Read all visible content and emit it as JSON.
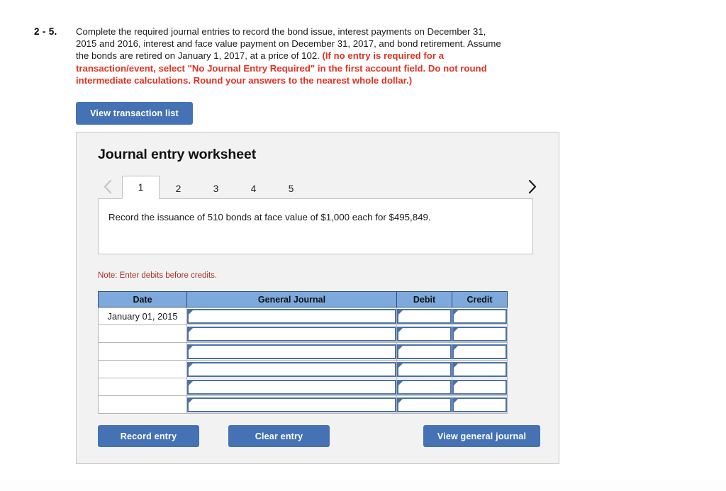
{
  "question": {
    "number": "2 - 5.",
    "text_plain_1": "Complete the required journal entries to record the bond issue, interest payments on December 31, 2015 and 2016, interest and face value payment on December 31, 2017, and bond retirement. Assume the bonds are retired on January 1, 2017, at a price of 102. ",
    "text_emphasis": "(If no entry is required for a transaction/event, select \"No Journal Entry Required\" in the first account field. Do not round intermediate calculations. Round your answers to the nearest whole dollar.)"
  },
  "toolbar": {
    "view_transaction_list_label": "View transaction list"
  },
  "worksheet": {
    "title": "Journal entry worksheet",
    "prev_icon": "chevron-left-icon",
    "next_icon": "chevron-right-icon",
    "tabs": [
      {
        "label": "1",
        "active": true
      },
      {
        "label": "2",
        "active": false
      },
      {
        "label": "3",
        "active": false
      },
      {
        "label": "4",
        "active": false
      },
      {
        "label": "5",
        "active": false
      }
    ],
    "description": "Record the issuance of 510 bonds at face value of $1,000 each for $495,849.",
    "note": "Note: Enter debits before credits.",
    "table": {
      "columns": [
        "Date",
        "General Journal",
        "Debit",
        "Credit"
      ],
      "rows": [
        {
          "date": "January 01, 2015",
          "general_journal": "",
          "debit": "",
          "credit": ""
        },
        {
          "date": "",
          "general_journal": "",
          "debit": "",
          "credit": ""
        },
        {
          "date": "",
          "general_journal": "",
          "debit": "",
          "credit": ""
        },
        {
          "date": "",
          "general_journal": "",
          "debit": "",
          "credit": ""
        },
        {
          "date": "",
          "general_journal": "",
          "debit": "",
          "credit": ""
        },
        {
          "date": "",
          "general_journal": "",
          "debit": "",
          "credit": ""
        }
      ]
    },
    "actions": {
      "record_entry_label": "Record entry",
      "clear_entry_label": "Clear entry",
      "view_general_journal_label": "View general journal"
    }
  },
  "colors": {
    "button_blue": "#4472b4",
    "table_header_blue": "#7da9dc",
    "input_border_blue": "#4a72a8",
    "emphasis_red": "#e03223",
    "note_red": "#a93226",
    "panel_bg": "#f2f2f2"
  }
}
